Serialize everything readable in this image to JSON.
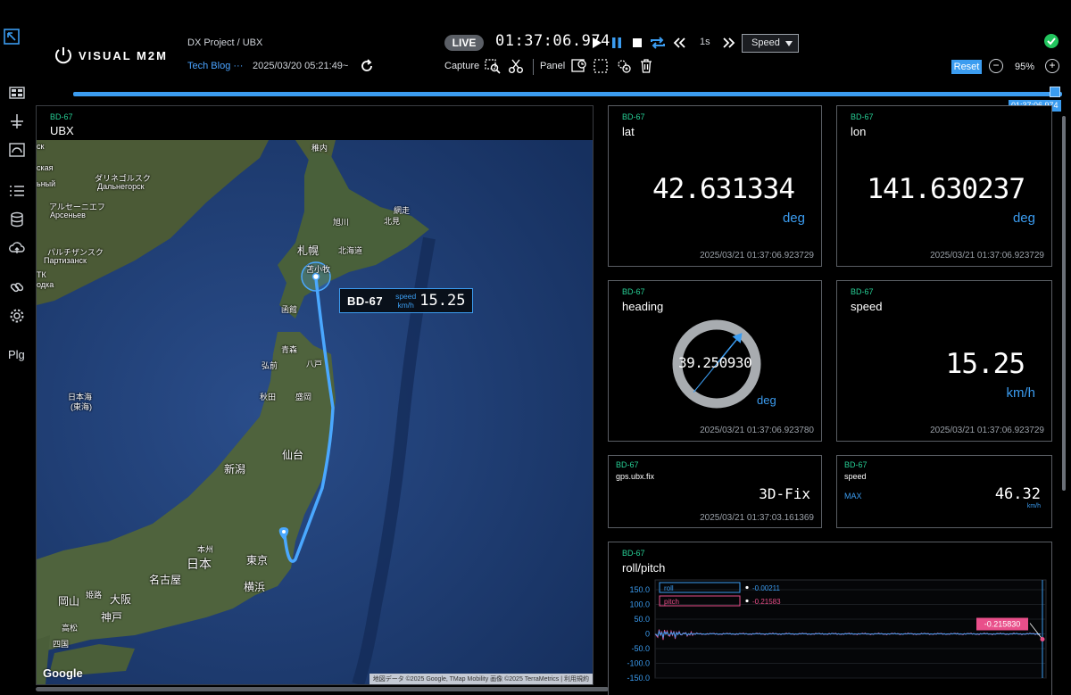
{
  "header": {
    "logo": "VISUAL M2M",
    "breadcrumb": "DX Project / UBX",
    "blog_link": "Tech Blog ···",
    "timestamp": "2025/03/20 05:21:49~",
    "live": "LIVE",
    "clock": "01:37:06.974",
    "step": "1s",
    "speed_select": "Speed",
    "capture": "Capture",
    "panel": "Panel",
    "reset": "Reset",
    "zoom": "95%",
    "zoom_minus": "−",
    "zoom_plus": "+"
  },
  "sidebar": {
    "plg": "Plg"
  },
  "timeline": {
    "label": "01:37:06.974",
    "progress": 0.99
  },
  "map_panel": {
    "id": "BD-67",
    "title": "UBX",
    "vehicle": "BD-67",
    "speed_label_1": "speed",
    "speed_label_2": "km/h",
    "speed_value": "15.25",
    "google": "Google",
    "attribution": "地図データ ©2025 Google, TMap Mobility 画像 ©2025 TerraMetrics | 利用規約",
    "labels": {
      "wakkanai": "稚内",
      "sapporo": "札幌",
      "tomakomai": "苫小牧",
      "asahikawa": "旭川",
      "abashiri": "網走",
      "kitami": "北見",
      "hokkaido": "北海道",
      "hakodate": "函館",
      "aomori": "青森",
      "hirosaki": "弘前",
      "hachinohe": "八戸",
      "akita": "秋田",
      "morioka": "盛岡",
      "sendai": "仙台",
      "niigata": "新潟",
      "japan_sea_1": "日本海",
      "japan_sea_2": "(東海)",
      "honshu": "本州",
      "nihon": "日本",
      "tokyo": "東京",
      "yokohama": "横浜",
      "nagoya": "名古屋",
      "osaka": "大阪",
      "okayama": "岡山",
      "himeji": "姫路",
      "kobe": "神戸",
      "takamatsu": "高松",
      "shikoku": "四国",
      "dalnegorsk_1": "ダリネゴルスク",
      "dalnegorsk_2": "Дальнегорск",
      "arsenyev_1": "アルセーニエフ",
      "arsenyev_2": "Арсеньев",
      "partizansk_1": "パルチザンスク",
      "partizansk_2": "Партизанск",
      "edge_1": "ск",
      "edge_2": "ская",
      "edge_3": "ьный",
      "edge_4": "ТК",
      "edge_5": "одка"
    }
  },
  "widgets": {
    "lat": {
      "id": "BD-67",
      "title": "lat",
      "value": "42.631334",
      "unit": "deg",
      "ts": "2025/03/21 01:37:06.923729"
    },
    "lon": {
      "id": "BD-67",
      "title": "lon",
      "value": "141.630237",
      "unit": "deg",
      "ts": "2025/03/21 01:37:06.923729"
    },
    "heading": {
      "id": "BD-67",
      "title": "heading",
      "value": "39.250930",
      "unit": "deg",
      "ts": "2025/03/21 01:37:06.923780",
      "angle": 39.25
    },
    "speed": {
      "id": "BD-67",
      "title": "speed",
      "value": "15.25",
      "unit": "km/h",
      "ts": "2025/03/21 01:37:06.923729"
    },
    "fix": {
      "id": "BD-67",
      "title": "gps.ubx.fix",
      "value": "3D-Fix",
      "ts": "2025/03/21 01:37:03.161369"
    },
    "maxspeed": {
      "id": "BD-67",
      "title": "speed",
      "max_label": "MAX",
      "value": "46.32",
      "unit": "km/h"
    },
    "rollpitch": {
      "id": "BD-67",
      "title": "roll/pitch"
    }
  },
  "chart_data": {
    "type": "line",
    "title": "roll/pitch",
    "yticks": [
      "150.0",
      "100.0",
      "50.0",
      "0",
      "-50.0",
      "-100.0",
      "-150.0"
    ],
    "ylim": [
      -150,
      150
    ],
    "series": [
      {
        "name": "roll",
        "last": "-0.00211",
        "color": "#3b9cf0"
      },
      {
        "name": "pitch",
        "last": "-0.21583",
        "color": "#e94f8a"
      }
    ],
    "cursor_value": "-0.215830"
  }
}
